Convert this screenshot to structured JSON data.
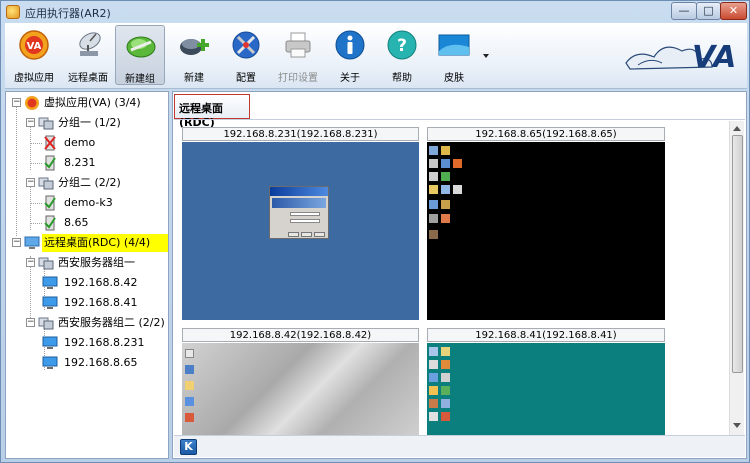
{
  "window": {
    "title": "应用执行器(AR2)",
    "min": "—",
    "max": "□",
    "close": "✕"
  },
  "toolbar": {
    "items": [
      {
        "label": "虚拟应用",
        "icon": "va-app-icon"
      },
      {
        "label": "远程桌面",
        "icon": "satellite-dish-icon"
      },
      {
        "label": "新建组",
        "icon": "new-group-icon",
        "active": true
      },
      {
        "label": "新建",
        "icon": "new-plus-icon"
      },
      {
        "label": "配置",
        "icon": "config-tools-icon"
      },
      {
        "label": "打印设置",
        "icon": "printer-icon",
        "disabled": true
      },
      {
        "label": "关于",
        "icon": "info-icon"
      },
      {
        "label": "帮助",
        "icon": "help-icon"
      },
      {
        "label": "皮肤",
        "icon": "skin-icon"
      }
    ],
    "logo_text": "VA"
  },
  "tree": {
    "va_root": "虚拟应用(VA) (3/4)",
    "group1": "分组一 (1/2)",
    "g1_items": [
      "demo",
      "8.231"
    ],
    "group2": "分组二 (2/2)",
    "g2_items": [
      "demo-k3",
      "8.65"
    ],
    "rdc_root": "远程桌面(RDC) (4/4)",
    "server_group1": "西安服务器组一",
    "sg1_items": [
      "192.168.8.42",
      "192.168.8.41"
    ],
    "server_group2": "西安服务器组二 (2/2)",
    "sg2_items": [
      "192.168.8.231",
      "192.168.8.65"
    ]
  },
  "content": {
    "tab_title": "远程桌面(RDC)",
    "sessions": [
      {
        "caption": "192.168.8.231(192.168.8.231)"
      },
      {
        "caption": "192.168.8.65(192.168.8.65)"
      },
      {
        "caption": "192.168.8.42(192.168.8.42)"
      },
      {
        "caption": "192.168.8.41(192.168.8.41)"
      }
    ],
    "k_button": "K"
  },
  "colors": {
    "selection": "#ffff00",
    "tab_border": "#c0392b"
  }
}
